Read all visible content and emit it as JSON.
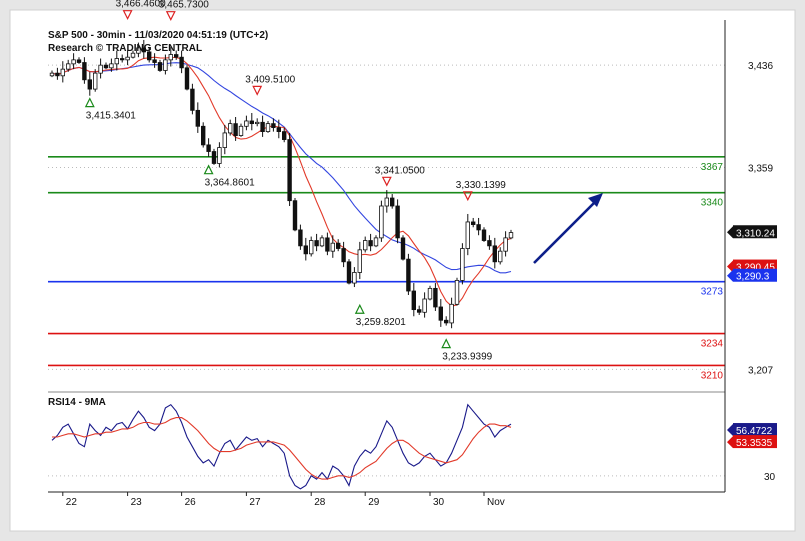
{
  "header": {
    "title": "S&P 500 - 30min - 11/03/2020 04:51:19 (UTC+2)",
    "subtitle": "Research © TRADING CENTRAL"
  },
  "chart_data": [
    {
      "type": "candlestick",
      "name": "price",
      "ylim": [
        3190,
        3470
      ],
      "y_ticks": [
        {
          "value": 3436,
          "label": "3,436"
        },
        {
          "value": 3359,
          "label": "3,359"
        },
        {
          "value": 3207,
          "label": "3,207"
        }
      ],
      "x_tick_labels": [
        {
          "label": "22",
          "x": 2
        },
        {
          "label": "23",
          "x": 14
        },
        {
          "label": "26",
          "x": 24
        },
        {
          "label": "27",
          "x": 36
        },
        {
          "label": "28",
          "x": 48
        },
        {
          "label": "29",
          "x": 58
        },
        {
          "label": "30",
          "x": 70
        },
        {
          "label": "Nov",
          "x": 80
        }
      ],
      "close": [
        3430,
        3428,
        3433,
        3437,
        3440,
        3438,
        3425,
        3418,
        3430,
        3436,
        3434,
        3437,
        3441,
        3440,
        3442,
        3445,
        3449,
        3446,
        3440,
        3438,
        3432,
        3440,
        3444,
        3442,
        3434,
        3418,
        3402,
        3390,
        3376,
        3371,
        3362,
        3374,
        3385,
        3392,
        3383,
        3390,
        3394,
        3392,
        3393,
        3386,
        3392,
        3389,
        3386,
        3380,
        3334,
        3312,
        3300,
        3294,
        3304,
        3300,
        3306,
        3296,
        3302,
        3298,
        3288,
        3272,
        3280,
        3297,
        3304,
        3300,
        3306,
        3330,
        3336,
        3330,
        3306,
        3290,
        3266,
        3252,
        3250,
        3260,
        3268,
        3254,
        3244,
        3242,
        3256,
        3274,
        3298,
        3318,
        3316,
        3312,
        3304,
        3300,
        3288,
        3296,
        3306,
        3310
      ],
      "annotations": [
        {
          "label": "3,466.4600",
          "x": 14,
          "y": 3466.46,
          "marker": "down"
        },
        {
          "label": "3,465.7300",
          "x": 22,
          "y": 3465.73,
          "marker": "down"
        },
        {
          "label": "3,415.3401",
          "x": 7,
          "y": 3415.34,
          "marker": "up"
        },
        {
          "label": "3,409.5100",
          "x": 38,
          "y": 3409.51,
          "marker": "down"
        },
        {
          "label": "3,364.8601",
          "x": 29,
          "y": 3364.86,
          "marker": "up"
        },
        {
          "label": "3,341.0500",
          "x": 62,
          "y": 3341.05,
          "marker": "down"
        },
        {
          "label": "3,330.1399",
          "x": 77,
          "y": 3330.14,
          "marker": "down"
        },
        {
          "label": "3,259.8201",
          "x": 57,
          "y": 3259.82,
          "marker": "up"
        },
        {
          "label": "3,233.9399",
          "x": 73,
          "y": 3233.94,
          "marker": "up"
        }
      ],
      "levels": [
        {
          "label": "3367",
          "value": 3367,
          "color": "#1a8a1a"
        },
        {
          "label": "3340",
          "value": 3340,
          "color": "#1a8a1a"
        },
        {
          "label": "3273",
          "value": 3273,
          "color": "#1a33ee"
        },
        {
          "label": "3234",
          "value": 3234,
          "color": "#dd1111"
        },
        {
          "label": "3210",
          "value": 3210,
          "color": "#dd1111"
        }
      ],
      "price_tags": [
        {
          "label": "3,310.24",
          "value": 3310.24,
          "color": "#111111"
        },
        {
          "label": "3,290.45",
          "value": 3290.45,
          "color": "#dd1111"
        },
        {
          "label": "3,290.3",
          "value": 3290.3,
          "color": "#1a33ee"
        }
      ],
      "ma_colors": {
        "fast": "#e23a2a",
        "slow": "#3346e0"
      }
    },
    {
      "type": "line",
      "name": "RSI14 - 9MA",
      "label": "RSI14 - 9MA",
      "ylim": [
        20,
        80
      ],
      "y_ticks": [
        {
          "value": 30,
          "label": "30"
        }
      ],
      "series": [
        {
          "color": "#1a1a8a",
          "values": [
            52,
            55,
            60,
            62,
            56,
            50,
            48,
            62,
            58,
            55,
            60,
            58,
            62,
            63,
            59,
            65,
            70,
            66,
            60,
            58,
            62,
            72,
            74,
            70,
            63,
            54,
            48,
            42,
            38,
            40,
            36,
            44,
            50,
            52,
            46,
            50,
            54,
            52,
            53,
            48,
            52,
            50,
            48,
            44,
            30,
            24,
            22,
            24,
            30,
            28,
            32,
            28,
            36,
            34,
            30,
            24,
            36,
            42,
            46,
            44,
            48,
            56,
            64,
            60,
            52,
            44,
            38,
            36,
            38,
            42,
            44,
            40,
            36,
            38,
            44,
            52,
            60,
            74,
            70,
            66,
            62,
            60,
            54,
            58,
            60,
            62
          ]
        },
        {
          "color": "#e23a2a",
          "values": [
            54,
            54,
            55,
            56,
            56,
            55,
            54,
            55,
            56,
            56,
            57,
            57,
            58,
            59,
            59,
            60,
            62,
            63,
            63,
            62,
            62,
            63,
            65,
            66,
            66,
            64,
            61,
            58,
            54,
            50,
            47,
            45,
            45,
            45,
            46,
            47,
            49,
            50,
            51,
            51,
            51,
            51,
            50,
            49,
            46,
            42,
            38,
            34,
            31,
            29,
            28,
            28,
            29,
            30,
            30,
            29,
            30,
            32,
            35,
            37,
            39,
            43,
            47,
            50,
            52,
            52,
            50,
            47,
            44,
            42,
            41,
            40,
            39,
            38,
            39,
            40,
            43,
            48,
            53,
            57,
            60,
            62,
            62,
            61,
            61,
            60
          ]
        }
      ],
      "tags": [
        {
          "label": "56.4722",
          "value": 56.4722,
          "color": "#1a1a8a"
        },
        {
          "label": "53.3535",
          "value": 53.3535,
          "color": "#dd1111"
        }
      ]
    }
  ]
}
